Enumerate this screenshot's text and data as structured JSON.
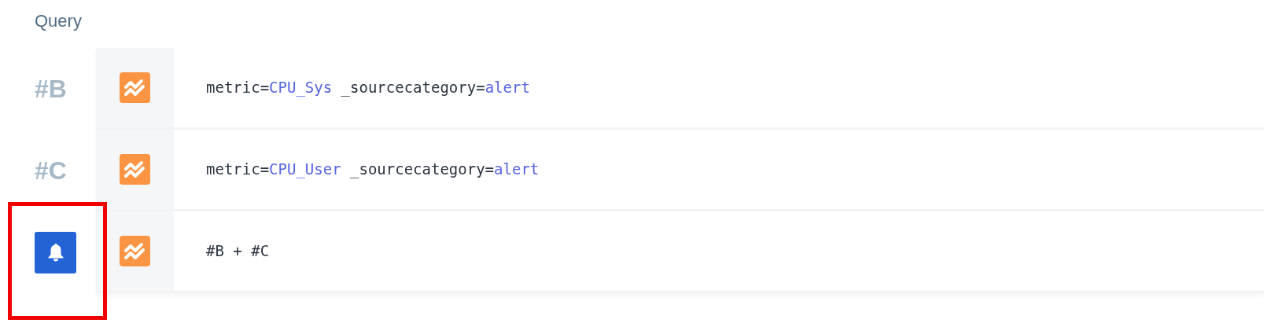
{
  "heading": "Query",
  "rows": [
    {
      "kind": "label",
      "label": "#B",
      "highlighted": false,
      "query": [
        {
          "kind": "plain",
          "text": "metric="
        },
        {
          "kind": "value",
          "text": "CPU_Sys"
        },
        {
          "kind": "plain",
          "text": " _sourcecategory="
        },
        {
          "kind": "value",
          "text": "alert"
        }
      ]
    },
    {
      "kind": "label",
      "label": "#C",
      "highlighted": false,
      "query": [
        {
          "kind": "plain",
          "text": "metric="
        },
        {
          "kind": "value",
          "text": "CPU_User"
        },
        {
          "kind": "plain",
          "text": " _sourcecategory="
        },
        {
          "kind": "value",
          "text": "alert"
        }
      ]
    },
    {
      "kind": "alert",
      "highlighted": true,
      "query": [
        {
          "kind": "plain",
          "text": "#B + #C"
        }
      ]
    }
  ]
}
